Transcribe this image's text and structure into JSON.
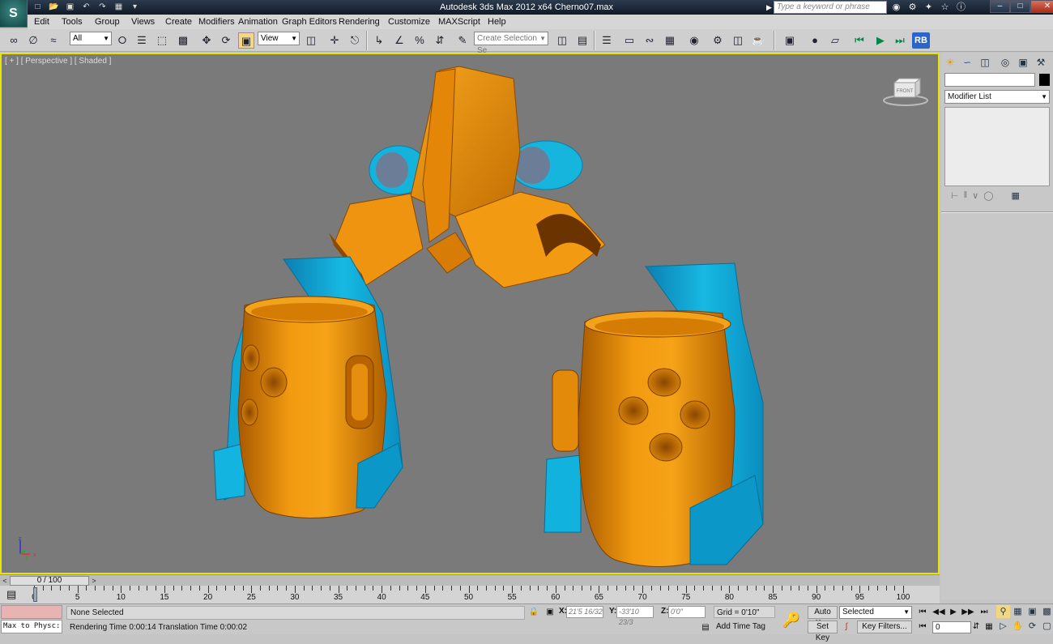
{
  "titlebar": {
    "logo": "S",
    "title": "Autodesk 3ds Max  2012 x64      Cherno07.max",
    "search_placeholder": "Type a keyword or phrase",
    "win_min": "–",
    "win_max": "□",
    "win_close": "✕"
  },
  "menu": [
    "Edit",
    "Tools",
    "Group",
    "Views",
    "Create",
    "Modifiers",
    "Animation",
    "Graph Editors",
    "Rendering",
    "Customize",
    "MAXScript",
    "Help"
  ],
  "toolbar": {
    "selection_filter": "All",
    "ref_coord": "View",
    "named_selection": "Create Selection Se",
    "rb_label": "RB"
  },
  "viewport": {
    "label": "[ + ] [ Perspective ] [ Shaded ]",
    "viewcube_face": "FRONT",
    "colors": {
      "background": "#7a7a7a",
      "orange": "#ef8f0c",
      "blue": "#12b4dd",
      "active_border": "#e6e600"
    }
  },
  "command_panel": {
    "modifier_list": "Modifier List"
  },
  "time_slider": {
    "position": "0 / 100",
    "prev": "<",
    "next": ">"
  },
  "trackbar": {
    "labels": [
      "0",
      "5",
      "10",
      "15",
      "20",
      "25",
      "30",
      "35",
      "40",
      "45",
      "50",
      "55",
      "60",
      "65",
      "70",
      "75",
      "80",
      "85",
      "90",
      "95",
      "100"
    ]
  },
  "status": {
    "maxscript_text": "Max to Physc:",
    "selection": "None Selected",
    "prompt": "Rendering Time  0:00:14    Translation Time  0:00:02",
    "x_label": "X:",
    "x_value": "21'5 16/32",
    "y_label": "Y:",
    "y_value": "-33'10 23/3",
    "z_label": "Z:",
    "z_value": "0'0\"",
    "grid": "Grid = 0'10\"",
    "add_time_tag": "Add Time Tag",
    "auto_key": "Auto Key",
    "set_key": "Set Key",
    "key_mode": "Selected",
    "key_filters": "Key Filters...",
    "current_frame": "0"
  }
}
